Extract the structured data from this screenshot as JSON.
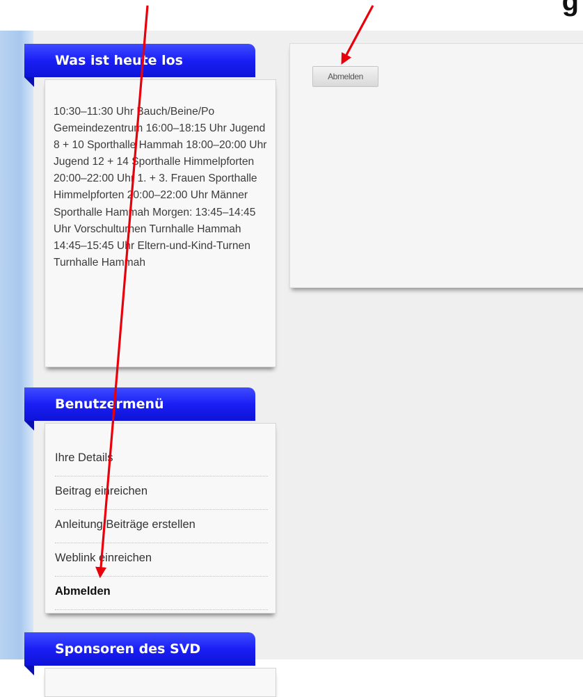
{
  "heading_fragment": "g",
  "modules": {
    "today": {
      "title": "Was ist heute los",
      "text": "10:30–11:30 Uhr Bauch/Beine/Po Gemeindezentrum 16:00–18:15 Uhr Jugend 8 + 10 Sporthalle Hammah 18:00–20:00 Uhr Jugend 12 + 14 Sporthalle Himmelpforten 20:00–22:00 Uhr 1. + 3. Frauen Sporthalle Himmelpforten 20:00–22:00 Uhr Männer Sporthalle Hammah Morgen: 13:45–14:45 Uhr Vorschulturnen Turnhalle Hammah 14:45–15:45 Uhr Eltern-und-Kind-Turnen Turnhalle Hammah"
    },
    "user_menu": {
      "title": "Benutzermenü",
      "items": [
        {
          "label": "Ihre Details"
        },
        {
          "label": "Beitrag einreichen"
        },
        {
          "label": "Anleitung Beiträge erstellen"
        },
        {
          "label": "Weblink einreichen"
        },
        {
          "label": "Abmelden"
        }
      ],
      "active_item": "Abmelden"
    },
    "sponsors": {
      "title": "Sponsoren des SVD"
    }
  },
  "main": {
    "logout_button_label": "Abmelden"
  },
  "colors": {
    "module_header": "#1a1ff5",
    "annotation_arrow": "#e8000b",
    "sidebar_strip": "#a8c8ee"
  }
}
